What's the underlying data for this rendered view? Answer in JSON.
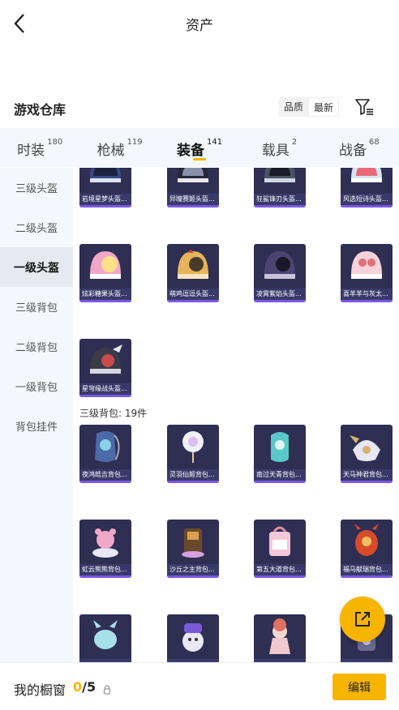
{
  "header": {
    "title": "资产"
  },
  "warehouse": {
    "title": "游戏仓库",
    "sort_options": [
      "品质",
      "最新"
    ],
    "selected_sort": "最新"
  },
  "tabs": [
    {
      "label": "时装",
      "count": "180"
    },
    {
      "label": "枪械",
      "count": "119"
    },
    {
      "label": "装备",
      "count": "141",
      "active": true
    },
    {
      "label": "载具",
      "count": "2"
    },
    {
      "label": "战备",
      "count": "68"
    }
  ],
  "sidebar": [
    {
      "label": "三级头盔"
    },
    {
      "label": "二级头盔"
    },
    {
      "label": "一级头盔",
      "active": true
    },
    {
      "label": "三级背包"
    },
    {
      "label": "二级背包"
    },
    {
      "label": "一级背包"
    },
    {
      "label": "背包挂件"
    }
  ],
  "helmets_row1": [
    "岩境星梦头盔...",
    "异瞳赛姬头盔...",
    "狂鲨锋刃头盔...",
    "风选短诗头盔..."
  ],
  "helmets_row2": [
    "炫彩糖果头盔...",
    "萌鸡逗逗头盔...",
    "凌霄紫焰头盔...",
    "喜羊羊与灰太..."
  ],
  "helmets_row3": [
    "星穹缘战头盔..."
  ],
  "section_backpack": "三级背包: 19件",
  "backpacks_row1": [
    "夜鸿皓吉背包...",
    "灵羽仙姬背包...",
    "南过天青背包...",
    "天马神君背包..."
  ],
  "backpacks_row2": [
    "虹云熊熊背包...",
    "沙丘之主背包...",
    "第五大道背包...",
    "福马献瑞背包..."
  ],
  "backpacks_row3": [
    "",
    "",
    "",
    ""
  ],
  "footer": {
    "showcase_label": "我的橱窗",
    "showcase_current": "0",
    "showcase_sep": "/",
    "showcase_max": "5",
    "edit_label": "编辑"
  },
  "colors": {
    "accent": "#f7b500",
    "card_bg": "#2f2f54",
    "card_bar": "#7a58e6"
  },
  "icons": {
    "back": "chevron-left-icon",
    "filter": "filter-icon",
    "fab": "external-share-icon",
    "lock": "lock-icon"
  }
}
